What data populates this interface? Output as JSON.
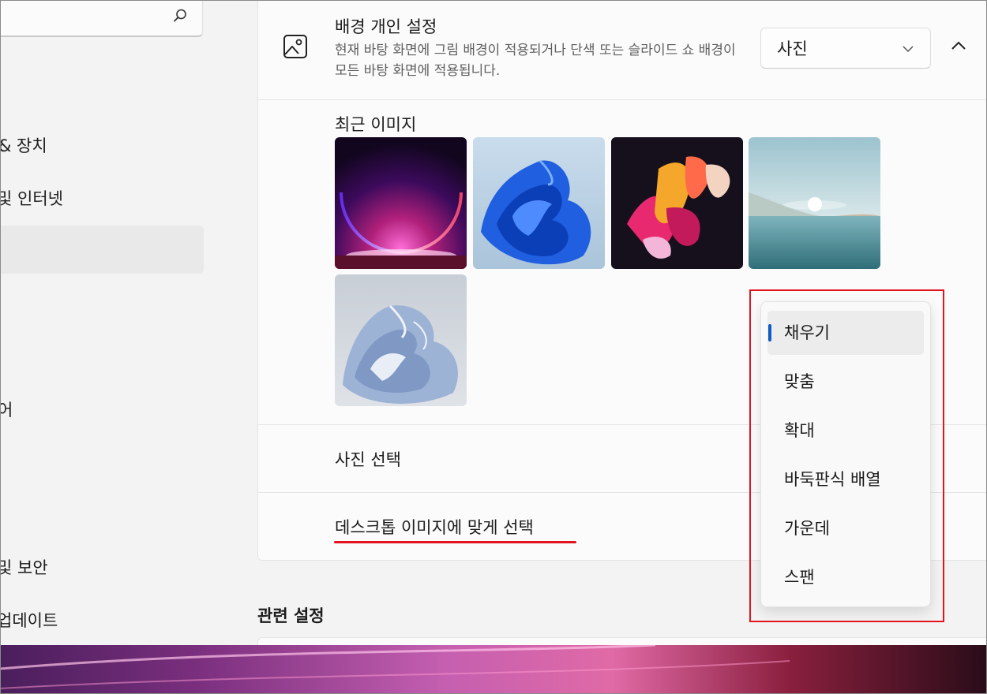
{
  "sidebar": {
    "items": [
      {
        "label": "& 장치"
      },
      {
        "label": "및 인터넷"
      },
      {
        "label": "어"
      },
      {
        "label": "및 보안"
      },
      {
        "label": "업데이트"
      }
    ]
  },
  "background": {
    "title": "배경 개인 설정",
    "description": "현재 바탕 화면에 그림 배경이 적용되거나 단색 또는 슬라이드 쇼 배경이 모든 바탕 화면에 적용됩니다.",
    "type_value": "사진",
    "recent_images_title": "최근 이미지",
    "choose_photo_label": "사진 선택",
    "fit_label": "데스크톱 이미지에 맞게 선택"
  },
  "fit_dropdown": {
    "options": [
      {
        "label": "채우기"
      },
      {
        "label": "맞춤"
      },
      {
        "label": "확대"
      },
      {
        "label": "바둑판식 배열"
      },
      {
        "label": "가운데"
      },
      {
        "label": "스팬"
      }
    ],
    "selected": "채우기"
  },
  "related": {
    "title": "관련 설정"
  },
  "colors": {
    "accent": "#0f5cc5",
    "annotation_red": "#e1141f"
  }
}
